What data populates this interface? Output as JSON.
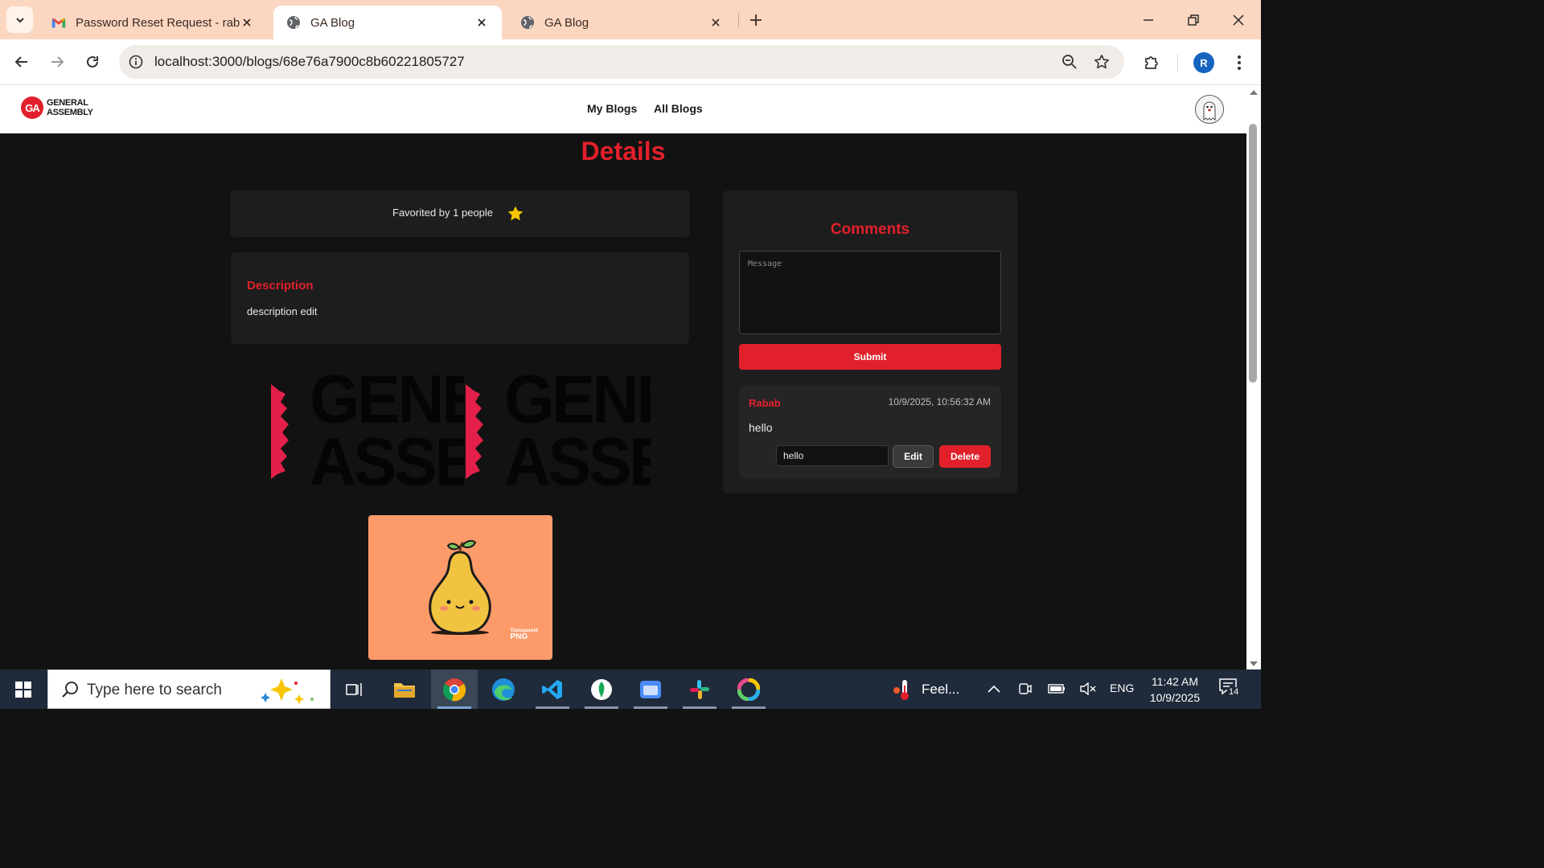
{
  "browser": {
    "tabs": [
      {
        "title": "Password Reset Request - rabab",
        "favicon": "gmail-icon"
      },
      {
        "title": "GA Blog",
        "favicon": "globe-icon",
        "active": true
      },
      {
        "title": "GA Blog",
        "favicon": "globe-icon"
      }
    ],
    "url": "localhost:3000/blogs/68e76a7900c8b60221805727",
    "profile_initial": "R"
  },
  "site": {
    "logo_text_line1": "GENERAL",
    "logo_text_line2": "ASSEMBLY",
    "logo_mark": "GA",
    "nav": {
      "my_blogs": "My Blogs",
      "all_blogs": "All Blogs"
    }
  },
  "details": {
    "title": "Details",
    "favorited_text": "Favorited by 1 people",
    "description_heading": "Description",
    "description_text": "description edit",
    "banner_line1": "GENERAL",
    "banner_line2": "ASSEMBLY",
    "image_watermark_line1": "Transparent",
    "image_watermark_line2": "PNG"
  },
  "comments": {
    "heading": "Comments",
    "message_placeholder": "Message",
    "submit_label": "Submit",
    "items": [
      {
        "author": "Rabab",
        "timestamp": "10/9/2025, 10:56:32 AM",
        "text": "hello",
        "edit_value": "hello",
        "edit_label": "Edit",
        "delete_label": "Delete"
      }
    ]
  },
  "taskbar": {
    "search_placeholder": "Type here to search",
    "weather_text": "Feel...",
    "language": "ENG",
    "time": "11:42 AM",
    "date": "10/9/2025",
    "notification_count": "14"
  },
  "colors": {
    "accent": "#e2202b",
    "background": "#121212",
    "card": "#1d1d1d",
    "tabstrip": "#fbd7c2"
  }
}
